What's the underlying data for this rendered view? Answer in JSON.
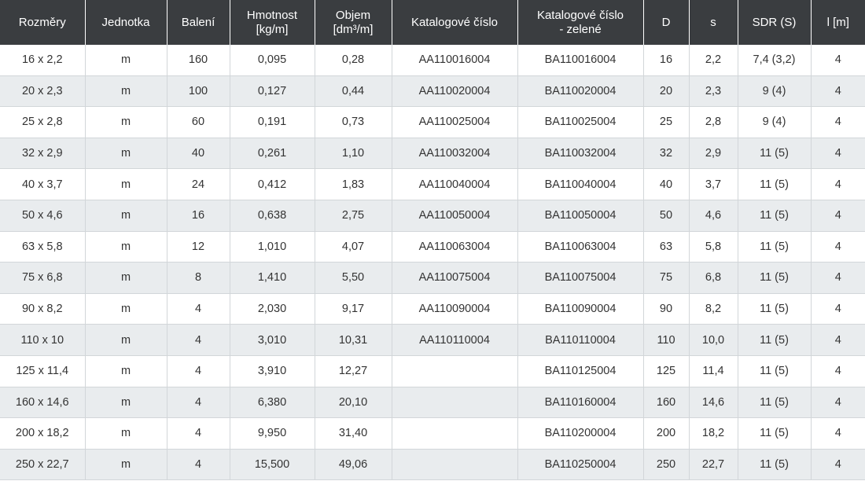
{
  "headers": [
    {
      "lines": [
        "Rozměry"
      ]
    },
    {
      "lines": [
        "Jednotka"
      ]
    },
    {
      "lines": [
        "Balení"
      ]
    },
    {
      "lines": [
        "Hmotnost",
        "[kg/m]"
      ]
    },
    {
      "lines": [
        "Objem",
        "[dm³/m]"
      ]
    },
    {
      "lines": [
        "Katalogové číslo"
      ]
    },
    {
      "lines": [
        "Katalogové číslo",
        "- zelené"
      ]
    },
    {
      "lines": [
        "D"
      ]
    },
    {
      "lines": [
        "s"
      ]
    },
    {
      "lines": [
        "SDR (S)"
      ]
    },
    {
      "lines": [
        "l [m]"
      ]
    }
  ],
  "rows": [
    [
      "16 x 2,2",
      "m",
      "160",
      "0,095",
      "0,28",
      "AA110016004",
      "BA110016004",
      "16",
      "2,2",
      "7,4 (3,2)",
      "4"
    ],
    [
      "20 x 2,3",
      "m",
      "100",
      "0,127",
      "0,44",
      "AA110020004",
      "BA110020004",
      "20",
      "2,3",
      "9 (4)",
      "4"
    ],
    [
      "25 x 2,8",
      "m",
      "60",
      "0,191",
      "0,73",
      "AA110025004",
      "BA110025004",
      "25",
      "2,8",
      "9 (4)",
      "4"
    ],
    [
      "32 x 2,9",
      "m",
      "40",
      "0,261",
      "1,10",
      "AA110032004",
      "BA110032004",
      "32",
      "2,9",
      "11 (5)",
      "4"
    ],
    [
      "40 x 3,7",
      "m",
      "24",
      "0,412",
      "1,83",
      "AA110040004",
      "BA110040004",
      "40",
      "3,7",
      "11 (5)",
      "4"
    ],
    [
      "50 x 4,6",
      "m",
      "16",
      "0,638",
      "2,75",
      "AA110050004",
      "BA110050004",
      "50",
      "4,6",
      "11 (5)",
      "4"
    ],
    [
      "63 x 5,8",
      "m",
      "12",
      "1,010",
      "4,07",
      "AA110063004",
      "BA110063004",
      "63",
      "5,8",
      "11 (5)",
      "4"
    ],
    [
      "75 x 6,8",
      "m",
      "8",
      "1,410",
      "5,50",
      "AA110075004",
      "BA110075004",
      "75",
      "6,8",
      "11 (5)",
      "4"
    ],
    [
      "90 x 8,2",
      "m",
      "4",
      "2,030",
      "9,17",
      "AA110090004",
      "BA110090004",
      "90",
      "8,2",
      "11 (5)",
      "4"
    ],
    [
      "110 x 10",
      "m",
      "4",
      "3,010",
      "10,31",
      "AA110110004",
      "BA110110004",
      "110",
      "10,0",
      "11 (5)",
      "4"
    ],
    [
      "125 x 11,4",
      "m",
      "4",
      "3,910",
      "12,27",
      "",
      "BA110125004",
      "125",
      "11,4",
      "11 (5)",
      "4"
    ],
    [
      "160 x 14,6",
      "m",
      "4",
      "6,380",
      "20,10",
      "",
      "BA110160004",
      "160",
      "14,6",
      "11 (5)",
      "4"
    ],
    [
      "200 x 18,2",
      "m",
      "4",
      "9,950",
      "31,40",
      "",
      "BA110200004",
      "200",
      "18,2",
      "11 (5)",
      "4"
    ],
    [
      "250 x 22,7",
      "m",
      "4",
      "15,500",
      "49,06",
      "",
      "BA110250004",
      "250",
      "22,7",
      "11 (5)",
      "4"
    ]
  ]
}
